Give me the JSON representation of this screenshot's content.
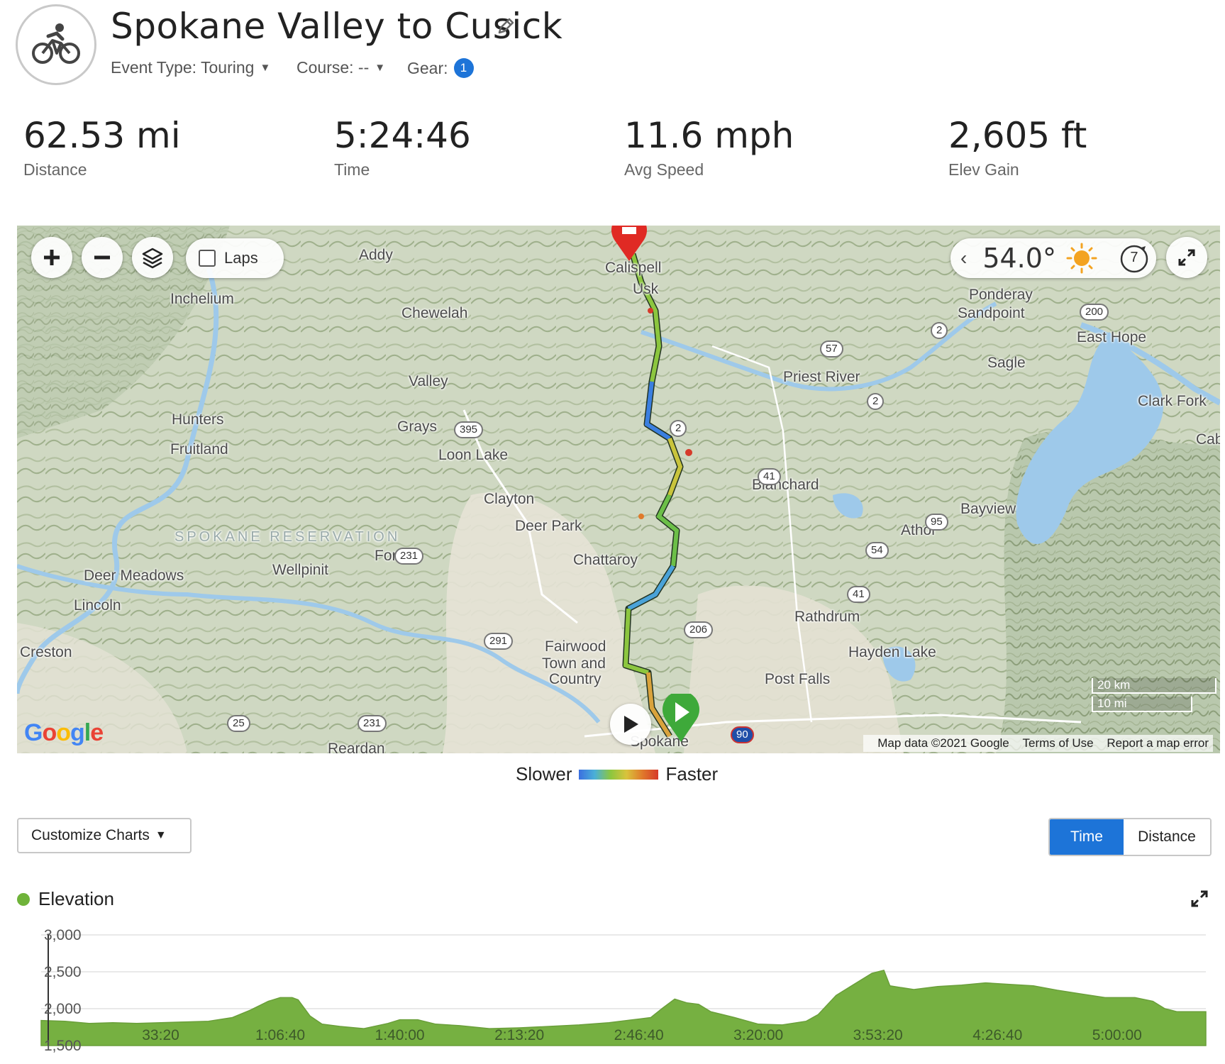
{
  "activity": {
    "title": "Spokane Valley to Cusick",
    "icon": "cycling-icon",
    "event_type_label": "Event Type: Touring",
    "course_label": "Course: --",
    "gear_label": "Gear:",
    "gear_count": "1"
  },
  "stats": [
    {
      "value": "62.53 mi",
      "label": "Distance"
    },
    {
      "value": "5:24:46",
      "label": "Time"
    },
    {
      "value": "11.6 mph",
      "label": "Avg Speed"
    },
    {
      "value": "2,605 ft",
      "label": "Elev Gain"
    }
  ],
  "map": {
    "laps_label": "Laps",
    "temperature": "54.0°",
    "wind_speed": "7",
    "footer": {
      "data": "Map data ©2021 Google",
      "terms": "Terms of Use",
      "report": "Report a map error"
    },
    "scale": {
      "km": "20 km",
      "mi": "10 mi"
    },
    "logo": "Google",
    "places": [
      "Addy",
      "Inchelium",
      "Chewelah",
      "Calispell",
      "Usk",
      "Ponderay",
      "Sandpoint",
      "East Hope",
      "Sagle",
      "Valley",
      "Priest River",
      "Clark Fork",
      "Hunters",
      "Grays",
      "Cab",
      "Fruitland",
      "Loon Lake",
      "Blanchard",
      "Clayton",
      "Bayview",
      "Deer Park",
      "Athol",
      "SPOKANE RESERVATION",
      "Ford",
      "Wellpinit",
      "Deer Meadows",
      "Chattaroy",
      "Lincoln",
      "Rathdrum",
      "Fairwood",
      "Town and",
      "Country",
      "Creston",
      "Hayden Lake",
      "Post Falls",
      "Reardan",
      "Spokane"
    ],
    "shields": [
      "200",
      "2",
      "57",
      "2",
      "2",
      "395",
      "41",
      "95",
      "54",
      "231",
      "41",
      "206",
      "291",
      "25",
      "231",
      "90"
    ]
  },
  "legend": {
    "slower": "Slower",
    "faster": "Faster"
  },
  "controls": {
    "customize_label": "Customize Charts",
    "toggle_time": "Time",
    "toggle_distance": "Distance"
  },
  "chart_data": {
    "type": "area",
    "title": "Elevation",
    "series": [
      {
        "name": "Elevation",
        "color": "#76b041"
      }
    ],
    "x_unit": "elapsed time",
    "x_tick_labels": [
      "33:20",
      "1:06:40",
      "1:40:00",
      "2:13:20",
      "2:46:40",
      "3:20:00",
      "3:53:20",
      "4:26:40",
      "5:00:00"
    ],
    "x_tick_seconds": [
      2000,
      4000,
      6000,
      8000,
      10000,
      12000,
      14000,
      16000,
      18000
    ],
    "xlim": [
      0,
      19486
    ],
    "y_tick_labels": [
      "3,000",
      "2,500",
      "2,000",
      "1,500"
    ],
    "y_tick_values": [
      3000,
      2500,
      2000,
      1500
    ],
    "ylim": [
      1500,
      3000
    ],
    "points": [
      [
        0,
        1840
      ],
      [
        400,
        1830
      ],
      [
        800,
        1800
      ],
      [
        1200,
        1810
      ],
      [
        1600,
        1800
      ],
      [
        2000,
        1810
      ],
      [
        2400,
        1820
      ],
      [
        2800,
        1830
      ],
      [
        3200,
        1880
      ],
      [
        3500,
        1980
      ],
      [
        3800,
        2100
      ],
      [
        4000,
        2150
      ],
      [
        4200,
        2150
      ],
      [
        4300,
        2120
      ],
      [
        4500,
        1900
      ],
      [
        4700,
        1790
      ],
      [
        5000,
        1760
      ],
      [
        5400,
        1730
      ],
      [
        5800,
        1800
      ],
      [
        6000,
        1850
      ],
      [
        6300,
        1850
      ],
      [
        6600,
        1790
      ],
      [
        7000,
        1770
      ],
      [
        7500,
        1730
      ],
      [
        8000,
        1740
      ],
      [
        8500,
        1760
      ],
      [
        9000,
        1780
      ],
      [
        9500,
        1810
      ],
      [
        10000,
        1860
      ],
      [
        10200,
        1880
      ],
      [
        10400,
        2010
      ],
      [
        10600,
        2130
      ],
      [
        10800,
        2080
      ],
      [
        11000,
        2060
      ],
      [
        11200,
        1960
      ],
      [
        11600,
        1880
      ],
      [
        12000,
        1790
      ],
      [
        12400,
        1780
      ],
      [
        12800,
        1830
      ],
      [
        13000,
        1920
      ],
      [
        13300,
        2180
      ],
      [
        13600,
        2330
      ],
      [
        13900,
        2480
      ],
      [
        14100,
        2520
      ],
      [
        14200,
        2310
      ],
      [
        14600,
        2260
      ],
      [
        15000,
        2300
      ],
      [
        15400,
        2320
      ],
      [
        15800,
        2350
      ],
      [
        16200,
        2330
      ],
      [
        16600,
        2310
      ],
      [
        17000,
        2250
      ],
      [
        17400,
        2200
      ],
      [
        17800,
        2150
      ],
      [
        18300,
        2150
      ],
      [
        18600,
        2100
      ],
      [
        18800,
        2000
      ],
      [
        19000,
        1960
      ],
      [
        19486,
        1960
      ]
    ]
  },
  "colors": {
    "accent": "#1d74d8",
    "elevation": "#76b041",
    "start": "#3ea93a",
    "end": "#e02a24"
  }
}
